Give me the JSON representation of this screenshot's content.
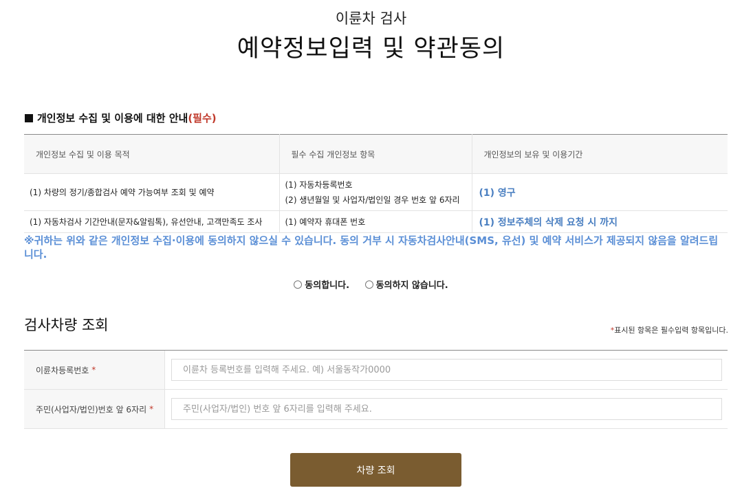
{
  "header": {
    "subtitle": "이륜차 검사",
    "title": "예약정보입력 및 약관동의"
  },
  "privacy": {
    "heading": "개인정보 수집 및 이용에 대한 안내",
    "required_tag": "(필수)",
    "columns": [
      "개인정보 수집 및 이용 목적",
      "필수 수집 개인정보 항목",
      "개인정보의 보유 및 이용기간"
    ],
    "rows": [
      {
        "purpose": "(1) 차량의 정기/종합검사 예약 가능여부 조회 및 예약",
        "items": [
          "(1) 자동차등록번호",
          "(2) 생년월일 및 사업자/법인일 경우 번호 앞 6자리"
        ],
        "period": "(1) 영구"
      },
      {
        "purpose": "(1) 자동차검사 기간안내(문자&알림톡), 유선안내, 고객만족도 조사",
        "items": [
          "(1) 예약자 휴대폰 번호"
        ],
        "period": "(1) 정보주체의 삭제 요청 시 까지"
      }
    ],
    "notice": "※귀하는 위와 같은 개인정보 수집·이용에 동의하지 않으실 수 있습니다. 동의 거부 시 자동차검사안내(SMS, 유선) 및 예약 서비스가 제공되지 않음을 알려드립니다.",
    "agree_label": "동의합니다.",
    "disagree_label": "동의하지 않습니다."
  },
  "lookup": {
    "title": "검사차량 조회",
    "required_note_star": "*",
    "required_note": "표시된 항목은 필수입력 항목입니다.",
    "fields": [
      {
        "label": "이륜차등록번호",
        "star": "*",
        "placeholder": "이륜차 등록번호를 입력해 주세요. 예) 서울동작가0000",
        "value": ""
      },
      {
        "label": "주민(사업자/법인)번호 앞 6자리",
        "star": "*",
        "placeholder": "주민(사업자/법인) 번호 앞 6자리를 입력해 주세요.",
        "value": ""
      }
    ],
    "submit_label": "차량 조회"
  },
  "colors": {
    "accent": "#7a5c30",
    "notice_blue": "#5b8fd6",
    "required_red": "#c0392b"
  }
}
